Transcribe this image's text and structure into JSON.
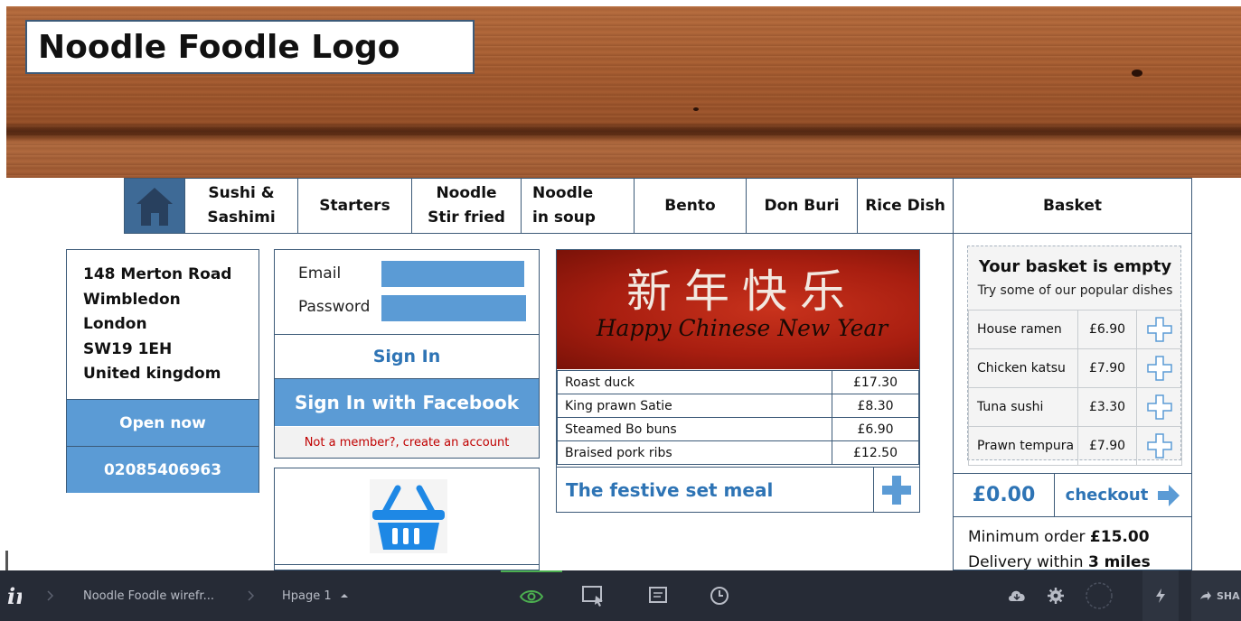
{
  "header": {
    "logo_text": "Noodle Foodle Logo"
  },
  "nav": {
    "home_icon": "home-icon",
    "items": [
      {
        "label": "Sushi & Sashimi"
      },
      {
        "label": "Starters"
      },
      {
        "label": "Noodle Stir fried"
      },
      {
        "label": "Noodle in soup"
      },
      {
        "label": "Bento"
      },
      {
        "label": "Don Buri"
      },
      {
        "label": "Rice Dish"
      }
    ],
    "basket_label": "Basket"
  },
  "address": {
    "lines": [
      "148 Merton  Road",
      "Wimbledon",
      "London",
      "SW19 1EH",
      "United kingdom"
    ],
    "open_now": "Open now",
    "phone": "02085406963"
  },
  "login": {
    "email_label": "Email",
    "password_label": "Password",
    "sign_in": "Sign In",
    "sign_in_facebook": "Sign In with Facebook",
    "not_member": "Not a member?,   create an account"
  },
  "promo": {
    "chinese_text": "新年快乐",
    "greeting": "Happy Chinese New Year",
    "dishes": [
      {
        "name": "Roast duck",
        "price": "£17.30"
      },
      {
        "name": "King prawn Satie",
        "price": "£8.30"
      },
      {
        "name": "Steamed  Bo buns",
        "price": "£6.90"
      },
      {
        "name": "Braised pork ribs",
        "price": "£12.50"
      }
    ],
    "festive_label": "The festive set meal"
  },
  "basket": {
    "empty_title": "Your basket is empty",
    "empty_sub": "Try some of our popular dishes",
    "popular": [
      {
        "name": "House ramen",
        "price": "£6.90"
      },
      {
        "name": "Chicken katsu",
        "price": "£7.90"
      },
      {
        "name": "Tuna sushi",
        "price": "£3.30"
      },
      {
        "name": "Prawn tempura",
        "price": "£7.90"
      }
    ],
    "total": "£0.00",
    "checkout": "checkout",
    "min_order_prefix": "Minimum order ",
    "min_order_value": "£15.00",
    "delivery_prefix": "Delivery  within ",
    "delivery_value": "3 miles"
  },
  "toolbar": {
    "logo": "in",
    "project": "Noodle Foodle wirefr...",
    "page": "Hpage 1",
    "share": "SHA"
  },
  "colors": {
    "accent_blue": "#5b9bd5",
    "link_blue": "#2e74b5",
    "border": "#3c5a78",
    "toolbar_bg": "#262b36",
    "active_green": "#4caf50"
  }
}
